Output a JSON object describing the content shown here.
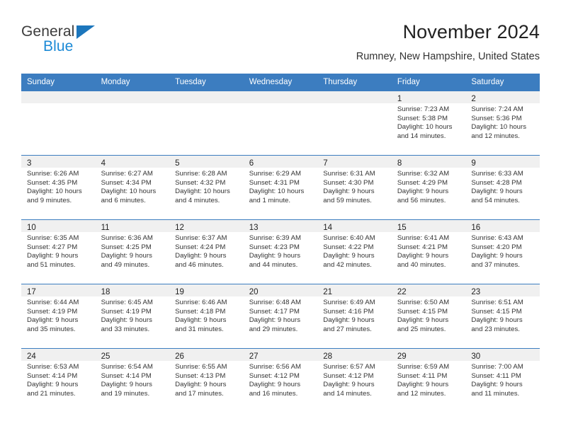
{
  "brand": {
    "name_part1": "General",
    "name_part2": "Blue",
    "triangle_color": "#1c76bc",
    "blue_color": "#1c8ad6"
  },
  "header": {
    "title": "November 2024",
    "subtitle": "Rumney, New Hampshire, United States"
  },
  "theme": {
    "header_bg": "#3c7dc0",
    "date_band_bg": "#f0f0f0",
    "grid_line": "#3c7dc0",
    "text": "#333333"
  },
  "weekday_headers": [
    "Sunday",
    "Monday",
    "Tuesday",
    "Wednesday",
    "Thursday",
    "Friday",
    "Saturday"
  ],
  "labels": {
    "sunrise_prefix": "Sunrise:",
    "sunset_prefix": "Sunset:",
    "daylight_prefix": "Daylight:"
  },
  "weeks": [
    [
      {
        "empty": true
      },
      {
        "empty": true
      },
      {
        "empty": true
      },
      {
        "empty": true
      },
      {
        "empty": true
      },
      {
        "date": "1",
        "sunrise": "Sunrise: 7:23 AM",
        "sunset": "Sunset: 5:38 PM",
        "daylight1": "Daylight: 10 hours",
        "daylight2": "and 14 minutes."
      },
      {
        "date": "2",
        "sunrise": "Sunrise: 7:24 AM",
        "sunset": "Sunset: 5:36 PM",
        "daylight1": "Daylight: 10 hours",
        "daylight2": "and 12 minutes."
      }
    ],
    [
      {
        "date": "3",
        "sunrise": "Sunrise: 6:26 AM",
        "sunset": "Sunset: 4:35 PM",
        "daylight1": "Daylight: 10 hours",
        "daylight2": "and 9 minutes."
      },
      {
        "date": "4",
        "sunrise": "Sunrise: 6:27 AM",
        "sunset": "Sunset: 4:34 PM",
        "daylight1": "Daylight: 10 hours",
        "daylight2": "and 6 minutes."
      },
      {
        "date": "5",
        "sunrise": "Sunrise: 6:28 AM",
        "sunset": "Sunset: 4:32 PM",
        "daylight1": "Daylight: 10 hours",
        "daylight2": "and 4 minutes."
      },
      {
        "date": "6",
        "sunrise": "Sunrise: 6:29 AM",
        "sunset": "Sunset: 4:31 PM",
        "daylight1": "Daylight: 10 hours",
        "daylight2": "and 1 minute."
      },
      {
        "date": "7",
        "sunrise": "Sunrise: 6:31 AM",
        "sunset": "Sunset: 4:30 PM",
        "daylight1": "Daylight: 9 hours",
        "daylight2": "and 59 minutes."
      },
      {
        "date": "8",
        "sunrise": "Sunrise: 6:32 AM",
        "sunset": "Sunset: 4:29 PM",
        "daylight1": "Daylight: 9 hours",
        "daylight2": "and 56 minutes."
      },
      {
        "date": "9",
        "sunrise": "Sunrise: 6:33 AM",
        "sunset": "Sunset: 4:28 PM",
        "daylight1": "Daylight: 9 hours",
        "daylight2": "and 54 minutes."
      }
    ],
    [
      {
        "date": "10",
        "sunrise": "Sunrise: 6:35 AM",
        "sunset": "Sunset: 4:27 PM",
        "daylight1": "Daylight: 9 hours",
        "daylight2": "and 51 minutes."
      },
      {
        "date": "11",
        "sunrise": "Sunrise: 6:36 AM",
        "sunset": "Sunset: 4:25 PM",
        "daylight1": "Daylight: 9 hours",
        "daylight2": "and 49 minutes."
      },
      {
        "date": "12",
        "sunrise": "Sunrise: 6:37 AM",
        "sunset": "Sunset: 4:24 PM",
        "daylight1": "Daylight: 9 hours",
        "daylight2": "and 46 minutes."
      },
      {
        "date": "13",
        "sunrise": "Sunrise: 6:39 AM",
        "sunset": "Sunset: 4:23 PM",
        "daylight1": "Daylight: 9 hours",
        "daylight2": "and 44 minutes."
      },
      {
        "date": "14",
        "sunrise": "Sunrise: 6:40 AM",
        "sunset": "Sunset: 4:22 PM",
        "daylight1": "Daylight: 9 hours",
        "daylight2": "and 42 minutes."
      },
      {
        "date": "15",
        "sunrise": "Sunrise: 6:41 AM",
        "sunset": "Sunset: 4:21 PM",
        "daylight1": "Daylight: 9 hours",
        "daylight2": "and 40 minutes."
      },
      {
        "date": "16",
        "sunrise": "Sunrise: 6:43 AM",
        "sunset": "Sunset: 4:20 PM",
        "daylight1": "Daylight: 9 hours",
        "daylight2": "and 37 minutes."
      }
    ],
    [
      {
        "date": "17",
        "sunrise": "Sunrise: 6:44 AM",
        "sunset": "Sunset: 4:19 PM",
        "daylight1": "Daylight: 9 hours",
        "daylight2": "and 35 minutes."
      },
      {
        "date": "18",
        "sunrise": "Sunrise: 6:45 AM",
        "sunset": "Sunset: 4:19 PM",
        "daylight1": "Daylight: 9 hours",
        "daylight2": "and 33 minutes."
      },
      {
        "date": "19",
        "sunrise": "Sunrise: 6:46 AM",
        "sunset": "Sunset: 4:18 PM",
        "daylight1": "Daylight: 9 hours",
        "daylight2": "and 31 minutes."
      },
      {
        "date": "20",
        "sunrise": "Sunrise: 6:48 AM",
        "sunset": "Sunset: 4:17 PM",
        "daylight1": "Daylight: 9 hours",
        "daylight2": "and 29 minutes."
      },
      {
        "date": "21",
        "sunrise": "Sunrise: 6:49 AM",
        "sunset": "Sunset: 4:16 PM",
        "daylight1": "Daylight: 9 hours",
        "daylight2": "and 27 minutes."
      },
      {
        "date": "22",
        "sunrise": "Sunrise: 6:50 AM",
        "sunset": "Sunset: 4:15 PM",
        "daylight1": "Daylight: 9 hours",
        "daylight2": "and 25 minutes."
      },
      {
        "date": "23",
        "sunrise": "Sunrise: 6:51 AM",
        "sunset": "Sunset: 4:15 PM",
        "daylight1": "Daylight: 9 hours",
        "daylight2": "and 23 minutes."
      }
    ],
    [
      {
        "date": "24",
        "sunrise": "Sunrise: 6:53 AM",
        "sunset": "Sunset: 4:14 PM",
        "daylight1": "Daylight: 9 hours",
        "daylight2": "and 21 minutes."
      },
      {
        "date": "25",
        "sunrise": "Sunrise: 6:54 AM",
        "sunset": "Sunset: 4:14 PM",
        "daylight1": "Daylight: 9 hours",
        "daylight2": "and 19 minutes."
      },
      {
        "date": "26",
        "sunrise": "Sunrise: 6:55 AM",
        "sunset": "Sunset: 4:13 PM",
        "daylight1": "Daylight: 9 hours",
        "daylight2": "and 17 minutes."
      },
      {
        "date": "27",
        "sunrise": "Sunrise: 6:56 AM",
        "sunset": "Sunset: 4:12 PM",
        "daylight1": "Daylight: 9 hours",
        "daylight2": "and 16 minutes."
      },
      {
        "date": "28",
        "sunrise": "Sunrise: 6:57 AM",
        "sunset": "Sunset: 4:12 PM",
        "daylight1": "Daylight: 9 hours",
        "daylight2": "and 14 minutes."
      },
      {
        "date": "29",
        "sunrise": "Sunrise: 6:59 AM",
        "sunset": "Sunset: 4:11 PM",
        "daylight1": "Daylight: 9 hours",
        "daylight2": "and 12 minutes."
      },
      {
        "date": "30",
        "sunrise": "Sunrise: 7:00 AM",
        "sunset": "Sunset: 4:11 PM",
        "daylight1": "Daylight: 9 hours",
        "daylight2": "and 11 minutes."
      }
    ]
  ]
}
